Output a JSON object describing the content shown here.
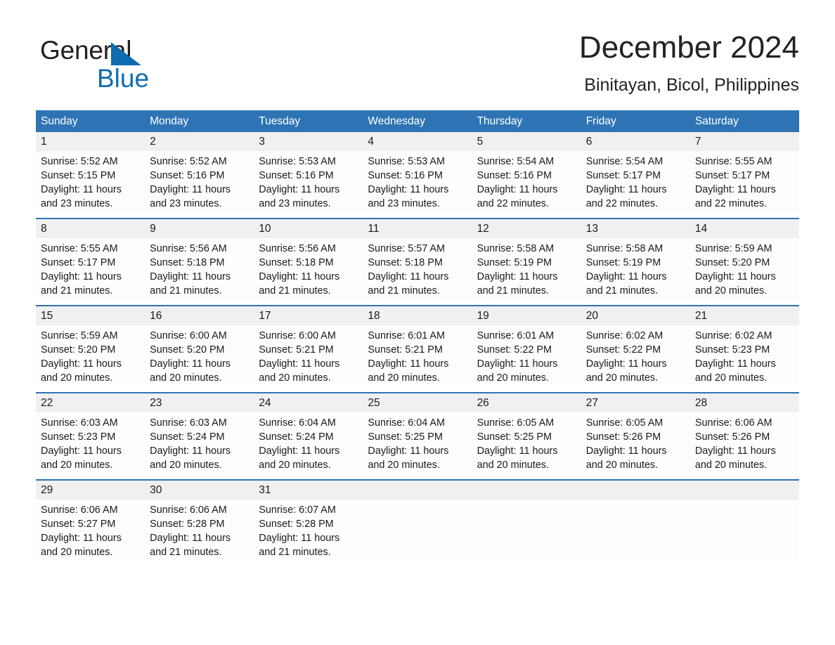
{
  "brand": {
    "logo_text_primary": "General",
    "logo_text_secondary": "Blue",
    "primary_color": "#106cb0",
    "header_color": "#2e74b5",
    "daynum_band_color": "#f0f0f0"
  },
  "header": {
    "title": "December 2024",
    "subtitle": "Binitayan, Bicol, Philippines"
  },
  "calendar": {
    "weekdays": [
      "Sunday",
      "Monday",
      "Tuesday",
      "Wednesday",
      "Thursday",
      "Friday",
      "Saturday"
    ],
    "weeks": [
      {
        "days": [
          {
            "num": "1",
            "sunrise": "Sunrise: 5:52 AM",
            "sunset": "Sunset: 5:15 PM",
            "daylight_1": "Daylight: 11 hours",
            "daylight_2": "and 23 minutes."
          },
          {
            "num": "2",
            "sunrise": "Sunrise: 5:52 AM",
            "sunset": "Sunset: 5:16 PM",
            "daylight_1": "Daylight: 11 hours",
            "daylight_2": "and 23 minutes."
          },
          {
            "num": "3",
            "sunrise": "Sunrise: 5:53 AM",
            "sunset": "Sunset: 5:16 PM",
            "daylight_1": "Daylight: 11 hours",
            "daylight_2": "and 23 minutes."
          },
          {
            "num": "4",
            "sunrise": "Sunrise: 5:53 AM",
            "sunset": "Sunset: 5:16 PM",
            "daylight_1": "Daylight: 11 hours",
            "daylight_2": "and 23 minutes."
          },
          {
            "num": "5",
            "sunrise": "Sunrise: 5:54 AM",
            "sunset": "Sunset: 5:16 PM",
            "daylight_1": "Daylight: 11 hours",
            "daylight_2": "and 22 minutes."
          },
          {
            "num": "6",
            "sunrise": "Sunrise: 5:54 AM",
            "sunset": "Sunset: 5:17 PM",
            "daylight_1": "Daylight: 11 hours",
            "daylight_2": "and 22 minutes."
          },
          {
            "num": "7",
            "sunrise": "Sunrise: 5:55 AM",
            "sunset": "Sunset: 5:17 PM",
            "daylight_1": "Daylight: 11 hours",
            "daylight_2": "and 22 minutes."
          }
        ]
      },
      {
        "days": [
          {
            "num": "8",
            "sunrise": "Sunrise: 5:55 AM",
            "sunset": "Sunset: 5:17 PM",
            "daylight_1": "Daylight: 11 hours",
            "daylight_2": "and 21 minutes."
          },
          {
            "num": "9",
            "sunrise": "Sunrise: 5:56 AM",
            "sunset": "Sunset: 5:18 PM",
            "daylight_1": "Daylight: 11 hours",
            "daylight_2": "and 21 minutes."
          },
          {
            "num": "10",
            "sunrise": "Sunrise: 5:56 AM",
            "sunset": "Sunset: 5:18 PM",
            "daylight_1": "Daylight: 11 hours",
            "daylight_2": "and 21 minutes."
          },
          {
            "num": "11",
            "sunrise": "Sunrise: 5:57 AM",
            "sunset": "Sunset: 5:18 PM",
            "daylight_1": "Daylight: 11 hours",
            "daylight_2": "and 21 minutes."
          },
          {
            "num": "12",
            "sunrise": "Sunrise: 5:58 AM",
            "sunset": "Sunset: 5:19 PM",
            "daylight_1": "Daylight: 11 hours",
            "daylight_2": "and 21 minutes."
          },
          {
            "num": "13",
            "sunrise": "Sunrise: 5:58 AM",
            "sunset": "Sunset: 5:19 PM",
            "daylight_1": "Daylight: 11 hours",
            "daylight_2": "and 21 minutes."
          },
          {
            "num": "14",
            "sunrise": "Sunrise: 5:59 AM",
            "sunset": "Sunset: 5:20 PM",
            "daylight_1": "Daylight: 11 hours",
            "daylight_2": "and 20 minutes."
          }
        ]
      },
      {
        "days": [
          {
            "num": "15",
            "sunrise": "Sunrise: 5:59 AM",
            "sunset": "Sunset: 5:20 PM",
            "daylight_1": "Daylight: 11 hours",
            "daylight_2": "and 20 minutes."
          },
          {
            "num": "16",
            "sunrise": "Sunrise: 6:00 AM",
            "sunset": "Sunset: 5:20 PM",
            "daylight_1": "Daylight: 11 hours",
            "daylight_2": "and 20 minutes."
          },
          {
            "num": "17",
            "sunrise": "Sunrise: 6:00 AM",
            "sunset": "Sunset: 5:21 PM",
            "daylight_1": "Daylight: 11 hours",
            "daylight_2": "and 20 minutes."
          },
          {
            "num": "18",
            "sunrise": "Sunrise: 6:01 AM",
            "sunset": "Sunset: 5:21 PM",
            "daylight_1": "Daylight: 11 hours",
            "daylight_2": "and 20 minutes."
          },
          {
            "num": "19",
            "sunrise": "Sunrise: 6:01 AM",
            "sunset": "Sunset: 5:22 PM",
            "daylight_1": "Daylight: 11 hours",
            "daylight_2": "and 20 minutes."
          },
          {
            "num": "20",
            "sunrise": "Sunrise: 6:02 AM",
            "sunset": "Sunset: 5:22 PM",
            "daylight_1": "Daylight: 11 hours",
            "daylight_2": "and 20 minutes."
          },
          {
            "num": "21",
            "sunrise": "Sunrise: 6:02 AM",
            "sunset": "Sunset: 5:23 PM",
            "daylight_1": "Daylight: 11 hours",
            "daylight_2": "and 20 minutes."
          }
        ]
      },
      {
        "days": [
          {
            "num": "22",
            "sunrise": "Sunrise: 6:03 AM",
            "sunset": "Sunset: 5:23 PM",
            "daylight_1": "Daylight: 11 hours",
            "daylight_2": "and 20 minutes."
          },
          {
            "num": "23",
            "sunrise": "Sunrise: 6:03 AM",
            "sunset": "Sunset: 5:24 PM",
            "daylight_1": "Daylight: 11 hours",
            "daylight_2": "and 20 minutes."
          },
          {
            "num": "24",
            "sunrise": "Sunrise: 6:04 AM",
            "sunset": "Sunset: 5:24 PM",
            "daylight_1": "Daylight: 11 hours",
            "daylight_2": "and 20 minutes."
          },
          {
            "num": "25",
            "sunrise": "Sunrise: 6:04 AM",
            "sunset": "Sunset: 5:25 PM",
            "daylight_1": "Daylight: 11 hours",
            "daylight_2": "and 20 minutes."
          },
          {
            "num": "26",
            "sunrise": "Sunrise: 6:05 AM",
            "sunset": "Sunset: 5:25 PM",
            "daylight_1": "Daylight: 11 hours",
            "daylight_2": "and 20 minutes."
          },
          {
            "num": "27",
            "sunrise": "Sunrise: 6:05 AM",
            "sunset": "Sunset: 5:26 PM",
            "daylight_1": "Daylight: 11 hours",
            "daylight_2": "and 20 minutes."
          },
          {
            "num": "28",
            "sunrise": "Sunrise: 6:06 AM",
            "sunset": "Sunset: 5:26 PM",
            "daylight_1": "Daylight: 11 hours",
            "daylight_2": "and 20 minutes."
          }
        ]
      },
      {
        "days": [
          {
            "num": "29",
            "sunrise": "Sunrise: 6:06 AM",
            "sunset": "Sunset: 5:27 PM",
            "daylight_1": "Daylight: 11 hours",
            "daylight_2": "and 20 minutes."
          },
          {
            "num": "30",
            "sunrise": "Sunrise: 6:06 AM",
            "sunset": "Sunset: 5:28 PM",
            "daylight_1": "Daylight: 11 hours",
            "daylight_2": "and 21 minutes."
          },
          {
            "num": "31",
            "sunrise": "Sunrise: 6:07 AM",
            "sunset": "Sunset: 5:28 PM",
            "daylight_1": "Daylight: 11 hours",
            "daylight_2": "and 21 minutes."
          },
          {
            "num": "",
            "sunrise": "",
            "sunset": "",
            "daylight_1": "",
            "daylight_2": ""
          },
          {
            "num": "",
            "sunrise": "",
            "sunset": "",
            "daylight_1": "",
            "daylight_2": ""
          },
          {
            "num": "",
            "sunrise": "",
            "sunset": "",
            "daylight_1": "",
            "daylight_2": ""
          },
          {
            "num": "",
            "sunrise": "",
            "sunset": "",
            "daylight_1": "",
            "daylight_2": ""
          }
        ]
      }
    ]
  }
}
